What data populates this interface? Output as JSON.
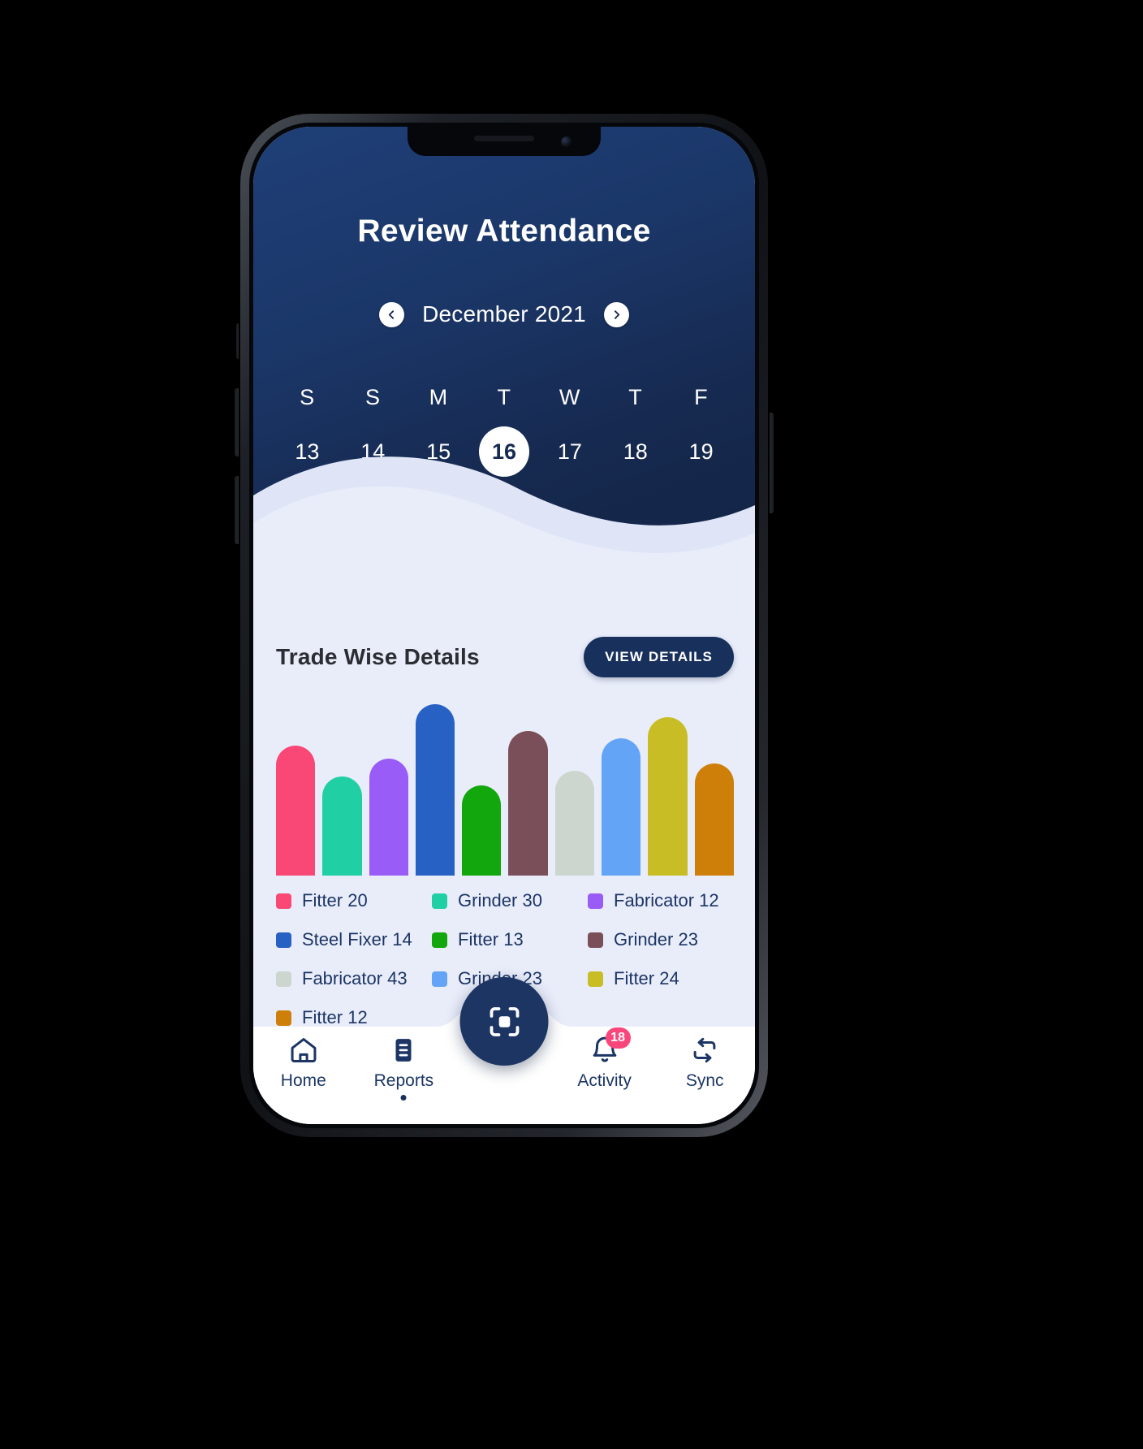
{
  "header": {
    "title": "Review Attendance",
    "month_label": "December 2021",
    "prev_icon": "chevron-left-icon",
    "next_icon": "chevron-right-icon",
    "weekdays": [
      "S",
      "S",
      "M",
      "T",
      "W",
      "T",
      "F"
    ],
    "dates": [
      "13",
      "14",
      "15",
      "16",
      "17",
      "18",
      "19"
    ],
    "selected_date": "16"
  },
  "main": {
    "section_title": "Trade Wise Details",
    "view_details_label": "VIEW DETAILS"
  },
  "chart_data": {
    "type": "bar",
    "title": "Trade Wise Details",
    "xlabel": "",
    "ylabel": "",
    "categories": [
      "Fitter",
      "Grinder",
      "Fabricator",
      "Steel Fixer",
      "Fitter",
      "Grinder",
      "Fabricator",
      "Grinder",
      "Fitter",
      "Fitter"
    ],
    "values": [
      20,
      30,
      12,
      14,
      13,
      23,
      43,
      23,
      24,
      12
    ],
    "bar_heights_pct": [
      72,
      55,
      65,
      95,
      50,
      80,
      58,
      76,
      88,
      62
    ],
    "colors": [
      "#f94876",
      "#21cfa5",
      "#9a5cf7",
      "#2761c4",
      "#11a70d",
      "#7b4f5a",
      "#ccd5ce",
      "#63a4f7",
      "#c9bd26",
      "#ce7f09"
    ],
    "legend_position": "below",
    "grid": false,
    "legend": [
      {
        "label": "Fitter 20",
        "color": "#f94876"
      },
      {
        "label": "Grinder 30",
        "color": "#21cfa5"
      },
      {
        "label": "Fabricator 12",
        "color": "#9a5cf7"
      },
      {
        "label": "Steel Fixer 14",
        "color": "#2761c4"
      },
      {
        "label": "Fitter 13",
        "color": "#11a70d"
      },
      {
        "label": "Grinder 23",
        "color": "#7b4f5a"
      },
      {
        "label": "Fabricator 43",
        "color": "#ccd5ce"
      },
      {
        "label": "Grinder 23",
        "color": "#63a4f7"
      },
      {
        "label": "Fitter 24",
        "color": "#c9bd26"
      },
      {
        "label": "Fitter 12",
        "color": "#ce7f09"
      }
    ]
  },
  "bottom_nav": {
    "items": [
      {
        "label": "Home",
        "icon": "home-icon",
        "active": false,
        "badge": ""
      },
      {
        "label": "Reports",
        "icon": "document-icon",
        "active": true,
        "badge": ""
      },
      {
        "label": "Activity",
        "icon": "bell-icon",
        "active": false,
        "badge": "18"
      },
      {
        "label": "Sync",
        "icon": "sync-icon",
        "active": false,
        "badge": ""
      }
    ],
    "fab_icon": "scan-icon"
  },
  "colors": {
    "header_navy": "#16294f",
    "accent_navy": "#18305c",
    "body_bg": "#e9edfa",
    "badge_pink": "#f9467b"
  }
}
